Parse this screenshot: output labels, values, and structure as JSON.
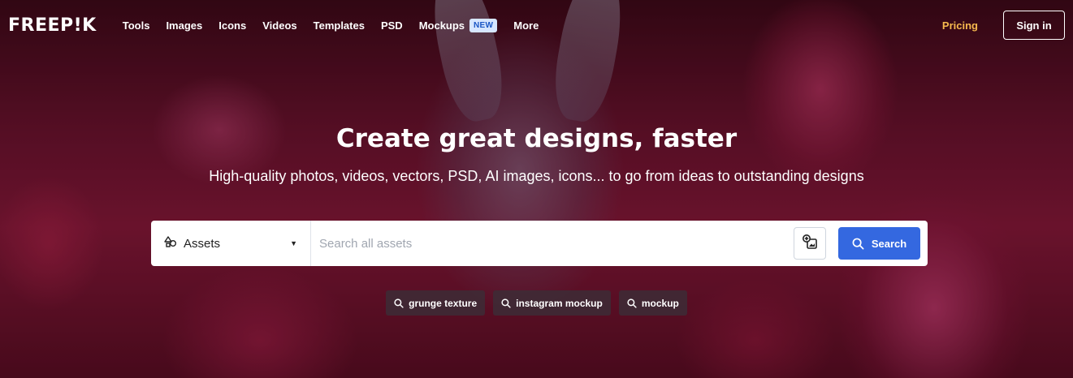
{
  "nav": {
    "logo": "FREEP!K",
    "links": [
      "Tools",
      "Images",
      "Icons",
      "Videos",
      "Templates",
      "PSD",
      "Mockups",
      "More"
    ],
    "mockups_badge": "NEW",
    "pricing": "Pricing",
    "sign_in": "Sign in"
  },
  "hero": {
    "headline": "Create great designs, faster",
    "subline": "High-quality photos, videos, vectors, PSD, AI images, icons... to go from ideas to outstanding designs"
  },
  "search": {
    "asset_type": "Assets",
    "placeholder": "Search all assets",
    "value": "",
    "button_label": "Search"
  },
  "tags": [
    "grunge texture",
    "instagram mockup",
    "mockup"
  ],
  "colors": {
    "accent_blue": "#3468e0",
    "pricing_gold": "#f6b94e",
    "badge_bg": "#d6e6ff",
    "badge_text": "#1a56c4"
  },
  "icons": {
    "asset_type": "shapes-icon",
    "dropdown": "caret-down-icon",
    "image_search": "image-search-icon",
    "search": "search-icon"
  }
}
